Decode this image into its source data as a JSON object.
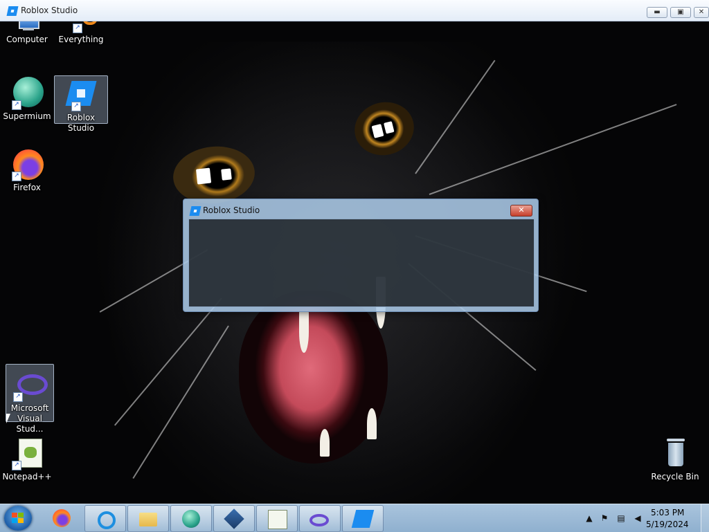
{
  "window": {
    "title": "Roblox Studio"
  },
  "dialog": {
    "title": "Roblox Studio",
    "close_label": "✕"
  },
  "desktop_icons": [
    {
      "label": "Computer"
    },
    {
      "label": "Everything"
    },
    {
      "label": "Supermium"
    },
    {
      "label": "Roblox Studio",
      "selected": true
    },
    {
      "label": "Firefox"
    },
    {
      "label": "Microsoft Visual Stud...",
      "selected": true
    },
    {
      "label": "Notepad++"
    },
    {
      "label": "Recycle Bin"
    }
  ],
  "taskbar": {
    "pinned": [
      "firefox-icon",
      "internet-explorer-icon",
      "file-explorer-icon",
      "supermium-icon",
      "virtualbox-icon",
      "notepadpp-icon",
      "visual-studio-icon",
      "roblox-studio-icon"
    ],
    "clock": {
      "time": "5:03 PM",
      "date": "5/19/2024"
    }
  },
  "colors": {
    "accent": "#1b8cf0",
    "taskbar": "#9cbad6",
    "close_red": "#c7402c"
  }
}
